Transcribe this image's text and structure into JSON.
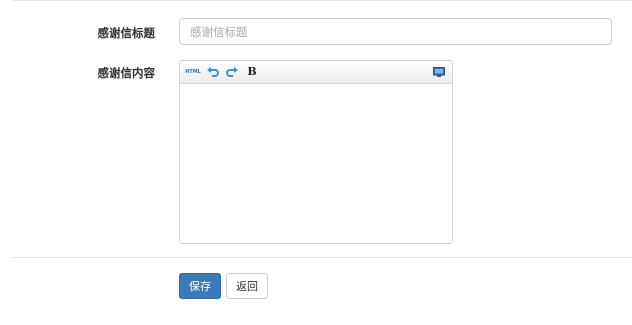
{
  "form": {
    "title_field": {
      "label": "感谢信标题",
      "placeholder": "感谢信标题",
      "value": ""
    },
    "content_field": {
      "label": "感谢信内容",
      "toolbar": {
        "html_label": "HTML",
        "undo_icon": "undo-icon",
        "redo_icon": "redo-icon",
        "bold_label": "B",
        "fullscreen_icon": "fullscreen-icon"
      },
      "value": ""
    }
  },
  "actions": {
    "save_label": "保存",
    "back_label": "返回"
  },
  "colors": {
    "primary": "#3c7ab8",
    "border": "#cccccc",
    "icon_blue": "#3a8fd6"
  }
}
